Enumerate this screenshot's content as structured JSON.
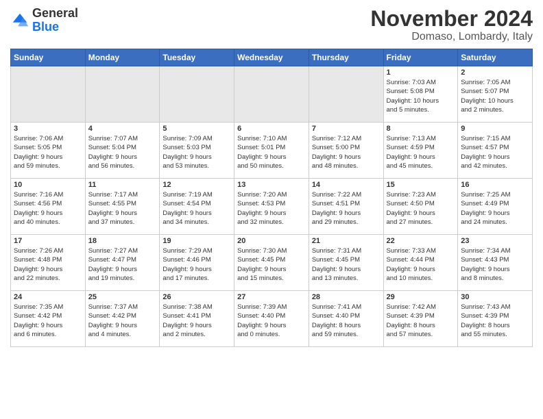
{
  "logo": {
    "line1": "General",
    "line2": "Blue"
  },
  "title": "November 2024",
  "location": "Domaso, Lombardy, Italy",
  "days_of_week": [
    "Sunday",
    "Monday",
    "Tuesday",
    "Wednesday",
    "Thursday",
    "Friday",
    "Saturday"
  ],
  "weeks": [
    [
      {
        "day": "",
        "info": ""
      },
      {
        "day": "",
        "info": ""
      },
      {
        "day": "",
        "info": ""
      },
      {
        "day": "",
        "info": ""
      },
      {
        "day": "",
        "info": ""
      },
      {
        "day": "1",
        "info": "Sunrise: 7:03 AM\nSunset: 5:08 PM\nDaylight: 10 hours\nand 5 minutes."
      },
      {
        "day": "2",
        "info": "Sunrise: 7:05 AM\nSunset: 5:07 PM\nDaylight: 10 hours\nand 2 minutes."
      }
    ],
    [
      {
        "day": "3",
        "info": "Sunrise: 7:06 AM\nSunset: 5:05 PM\nDaylight: 9 hours\nand 59 minutes."
      },
      {
        "day": "4",
        "info": "Sunrise: 7:07 AM\nSunset: 5:04 PM\nDaylight: 9 hours\nand 56 minutes."
      },
      {
        "day": "5",
        "info": "Sunrise: 7:09 AM\nSunset: 5:03 PM\nDaylight: 9 hours\nand 53 minutes."
      },
      {
        "day": "6",
        "info": "Sunrise: 7:10 AM\nSunset: 5:01 PM\nDaylight: 9 hours\nand 50 minutes."
      },
      {
        "day": "7",
        "info": "Sunrise: 7:12 AM\nSunset: 5:00 PM\nDaylight: 9 hours\nand 48 minutes."
      },
      {
        "day": "8",
        "info": "Sunrise: 7:13 AM\nSunset: 4:59 PM\nDaylight: 9 hours\nand 45 minutes."
      },
      {
        "day": "9",
        "info": "Sunrise: 7:15 AM\nSunset: 4:57 PM\nDaylight: 9 hours\nand 42 minutes."
      }
    ],
    [
      {
        "day": "10",
        "info": "Sunrise: 7:16 AM\nSunset: 4:56 PM\nDaylight: 9 hours\nand 40 minutes."
      },
      {
        "day": "11",
        "info": "Sunrise: 7:17 AM\nSunset: 4:55 PM\nDaylight: 9 hours\nand 37 minutes."
      },
      {
        "day": "12",
        "info": "Sunrise: 7:19 AM\nSunset: 4:54 PM\nDaylight: 9 hours\nand 34 minutes."
      },
      {
        "day": "13",
        "info": "Sunrise: 7:20 AM\nSunset: 4:53 PM\nDaylight: 9 hours\nand 32 minutes."
      },
      {
        "day": "14",
        "info": "Sunrise: 7:22 AM\nSunset: 4:51 PM\nDaylight: 9 hours\nand 29 minutes."
      },
      {
        "day": "15",
        "info": "Sunrise: 7:23 AM\nSunset: 4:50 PM\nDaylight: 9 hours\nand 27 minutes."
      },
      {
        "day": "16",
        "info": "Sunrise: 7:25 AM\nSunset: 4:49 PM\nDaylight: 9 hours\nand 24 minutes."
      }
    ],
    [
      {
        "day": "17",
        "info": "Sunrise: 7:26 AM\nSunset: 4:48 PM\nDaylight: 9 hours\nand 22 minutes."
      },
      {
        "day": "18",
        "info": "Sunrise: 7:27 AM\nSunset: 4:47 PM\nDaylight: 9 hours\nand 19 minutes."
      },
      {
        "day": "19",
        "info": "Sunrise: 7:29 AM\nSunset: 4:46 PM\nDaylight: 9 hours\nand 17 minutes."
      },
      {
        "day": "20",
        "info": "Sunrise: 7:30 AM\nSunset: 4:45 PM\nDaylight: 9 hours\nand 15 minutes."
      },
      {
        "day": "21",
        "info": "Sunrise: 7:31 AM\nSunset: 4:45 PM\nDaylight: 9 hours\nand 13 minutes."
      },
      {
        "day": "22",
        "info": "Sunrise: 7:33 AM\nSunset: 4:44 PM\nDaylight: 9 hours\nand 10 minutes."
      },
      {
        "day": "23",
        "info": "Sunrise: 7:34 AM\nSunset: 4:43 PM\nDaylight: 9 hours\nand 8 minutes."
      }
    ],
    [
      {
        "day": "24",
        "info": "Sunrise: 7:35 AM\nSunset: 4:42 PM\nDaylight: 9 hours\nand 6 minutes."
      },
      {
        "day": "25",
        "info": "Sunrise: 7:37 AM\nSunset: 4:42 PM\nDaylight: 9 hours\nand 4 minutes."
      },
      {
        "day": "26",
        "info": "Sunrise: 7:38 AM\nSunset: 4:41 PM\nDaylight: 9 hours\nand 2 minutes."
      },
      {
        "day": "27",
        "info": "Sunrise: 7:39 AM\nSunset: 4:40 PM\nDaylight: 9 hours\nand 0 minutes."
      },
      {
        "day": "28",
        "info": "Sunrise: 7:41 AM\nSunset: 4:40 PM\nDaylight: 8 hours\nand 59 minutes."
      },
      {
        "day": "29",
        "info": "Sunrise: 7:42 AM\nSunset: 4:39 PM\nDaylight: 8 hours\nand 57 minutes."
      },
      {
        "day": "30",
        "info": "Sunrise: 7:43 AM\nSunset: 4:39 PM\nDaylight: 8 hours\nand 55 minutes."
      }
    ]
  ],
  "empty_indices": [
    0,
    1,
    2,
    3,
    4
  ],
  "shaded_row1": [
    0,
    1,
    2,
    3,
    4
  ],
  "colors": {
    "header_bg": "#3c6ebf",
    "header_text": "#ffffff",
    "border": "#cccccc",
    "shaded": "#e8e8e8",
    "empty": "#f5f5f5"
  }
}
